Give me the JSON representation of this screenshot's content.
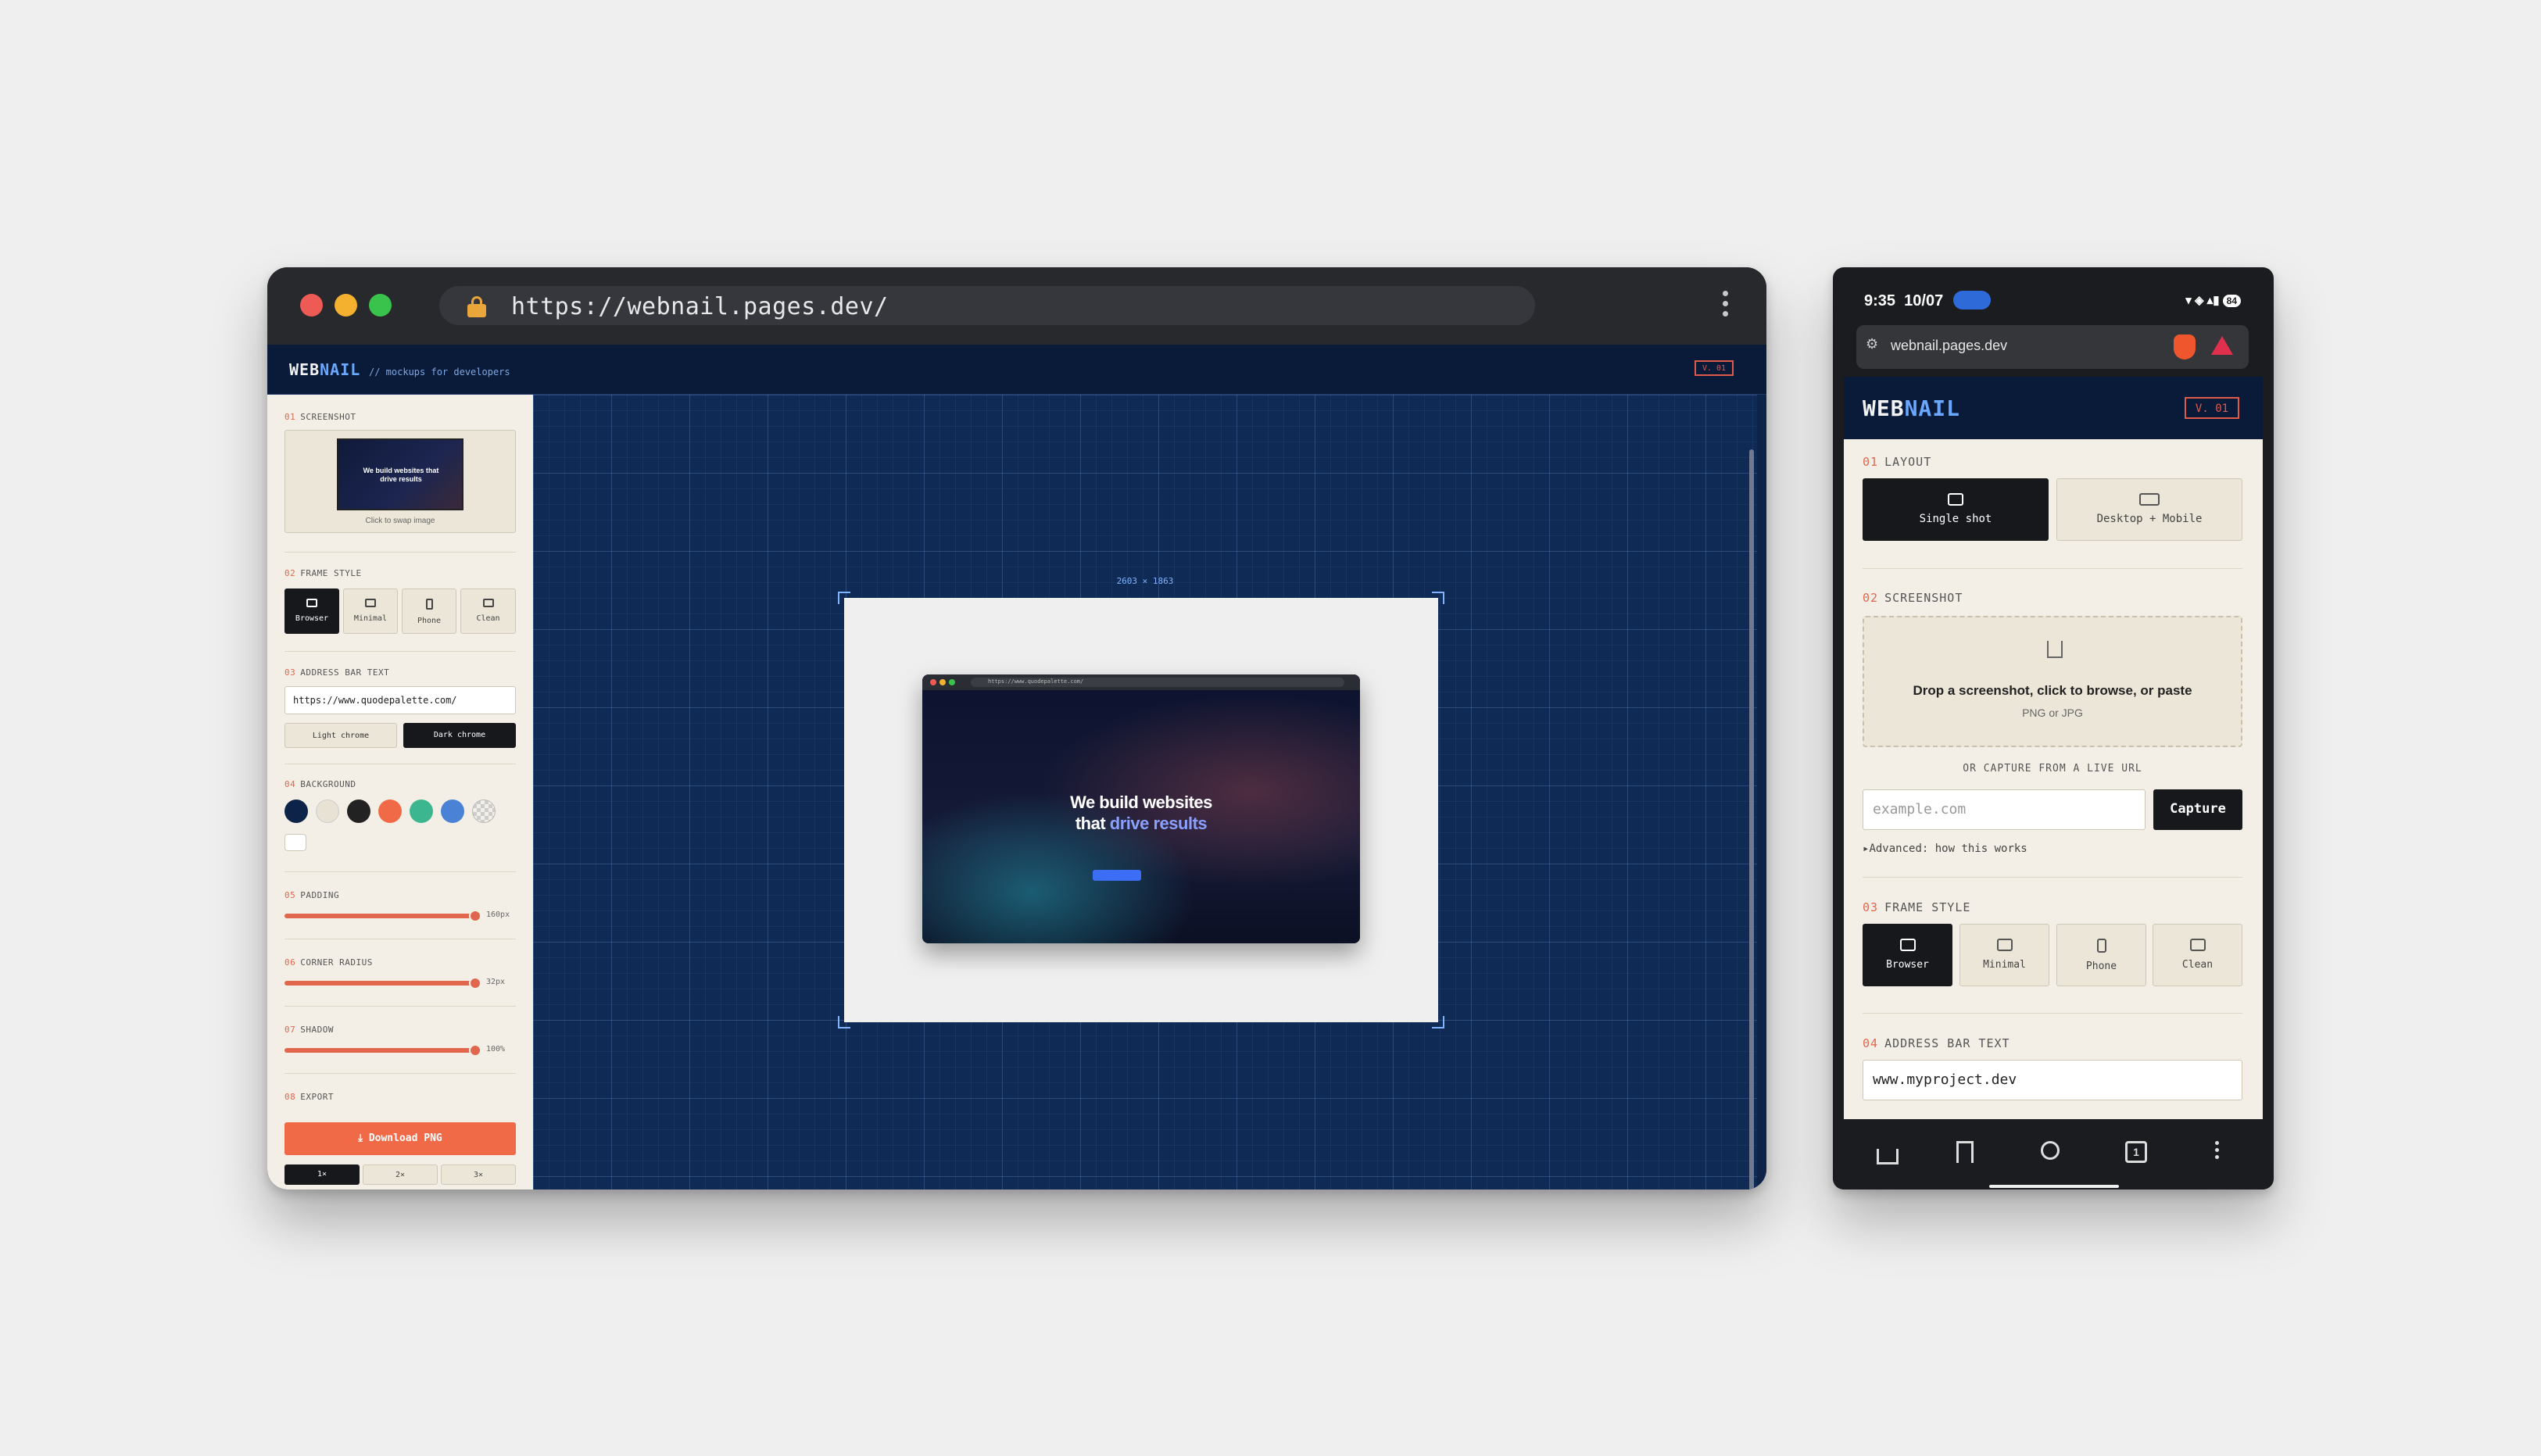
{
  "desktop": {
    "url": "https://webnail.pages.dev/",
    "app": {
      "logo_a": "WEB",
      "logo_b": "NAIL",
      "tagline": "// mockups for developers",
      "version": "V. 01"
    },
    "sidebar": {
      "s1": {
        "num": "01",
        "label": "SCREENSHOT",
        "thumb_title": "We build websites that drive results",
        "caption": "Click to swap image"
      },
      "s2": {
        "num": "02",
        "label": "FRAME STYLE",
        "options": [
          "Browser",
          "Minimal",
          "Phone",
          "Clean"
        ],
        "selected": "Browser"
      },
      "s3": {
        "num": "03",
        "label": "ADDRESS BAR TEXT",
        "value": "https://www.quodepalette.com/",
        "light": "Light chrome",
        "dark": "Dark chrome",
        "selected": "Dark chrome"
      },
      "s4": {
        "num": "04",
        "label": "BACKGROUND",
        "swatches": [
          "#0d2347",
          "#e8e2d4",
          "#222222",
          "#f06a48",
          "#3cb68f",
          "#4a82d6",
          "checker"
        ]
      },
      "s5": {
        "num": "05",
        "label": "PADDING",
        "value_label": "160px",
        "fraction": 0.95
      },
      "s6": {
        "num": "06",
        "label": "CORNER RADIUS",
        "value_label": "32px",
        "fraction": 0.95
      },
      "s7": {
        "num": "07",
        "label": "SHADOW",
        "value_label": "100%",
        "fraction": 0.95
      },
      "s8": {
        "num": "08",
        "label": "EXPORT",
        "download": "Download PNG",
        "scales": [
          "1×",
          "2×",
          "3×"
        ],
        "selected": "1×"
      }
    },
    "canvas": {
      "dims": "2603 × 1863",
      "mini_url": "https://www.quodepalette.com/",
      "headline_a": "We build websites",
      "headline_b": "that ",
      "headline_hl": "drive results"
    }
  },
  "phone": {
    "time": "9:35",
    "date": "10/07",
    "battery": "84",
    "url": "webnail.pages.dev",
    "app": {
      "logo_a": "WEB",
      "logo_b": "NAIL",
      "version": "V. 01"
    },
    "layout": {
      "num": "01",
      "label": "LAYOUT",
      "options": [
        "Single shot",
        "Desktop + Mobile"
      ],
      "selected": "Single shot"
    },
    "screenshot": {
      "num": "02",
      "label": "SCREENSHOT",
      "drop_title": "Drop a screenshot, click to browse, or paste",
      "drop_sub": "PNG or JPG"
    },
    "capture": {
      "or_label": "OR CAPTURE FROM A LIVE URL",
      "placeholder": "example.com",
      "button": "Capture",
      "advanced": "Advanced: how this works"
    },
    "frame": {
      "num": "03",
      "label": "FRAME STYLE",
      "options": [
        "Browser",
        "Minimal",
        "Phone",
        "Clean"
      ],
      "selected": "Browser"
    },
    "address": {
      "num": "04",
      "label": "ADDRESS BAR TEXT",
      "value": "www.myproject.dev"
    },
    "nav": {
      "tab_count": "1"
    }
  },
  "colors": {
    "accent": "#e0674d",
    "navy": "#0d2347",
    "blue_accent": "#6aa8ff",
    "download": "#f06a48"
  }
}
